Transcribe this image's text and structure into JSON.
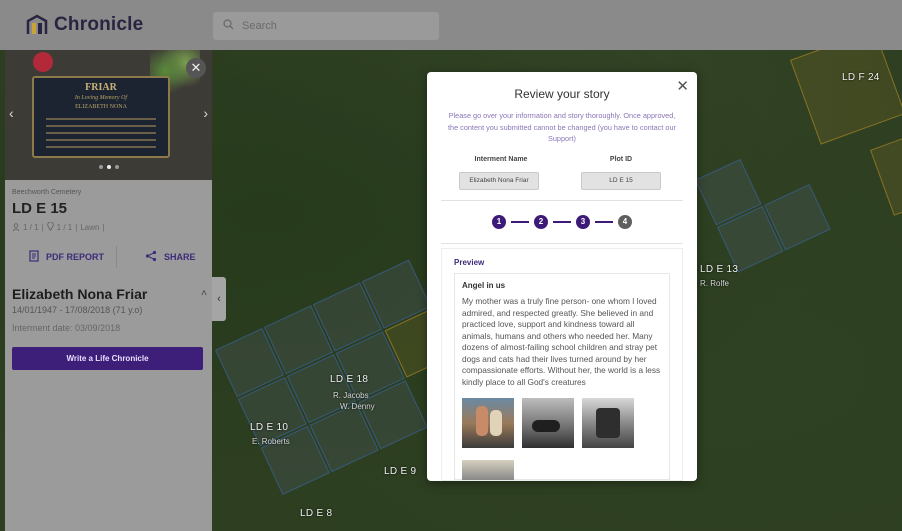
{
  "app": {
    "name": "Chronicle"
  },
  "search": {
    "placeholder": "Search"
  },
  "panel": {
    "cemetery": "Beechworth Cemetery",
    "plot_id": "LD E 15",
    "meta": {
      "people": "1 / 1",
      "plots": "1 / 1",
      "type": "Lawn"
    },
    "plaque": {
      "surname": "FRIAR",
      "subtitle": "In Loving Memory Of",
      "name": "ELIZABETH NONA"
    },
    "pdf_label": "PDF REPORT",
    "share_label": "SHARE",
    "person_name": "Elizabeth Nona Friar",
    "dates": "14/01/1947 - 17/08/2018 (71 y.o)",
    "interment": "Interment date: 03/09/2018",
    "life_button": "Write a Life Chronicle"
  },
  "map": {
    "labels": [
      "LD F 24",
      "LD E 13",
      "LD E 18",
      "LD E 10",
      "LD E 9",
      "LD E 8"
    ],
    "sublabels": [
      "R. Rolfe",
      "R. Jacobs",
      "W. Denny",
      "E. Roberts"
    ]
  },
  "modal": {
    "title": "Review your story",
    "description": "Please go over your information and story thoroughly. Once approved, the content you submitted cannot be changed (you have to contact our Support)",
    "interment_label": "Interment Name",
    "plot_label": "Plot ID",
    "interment_value": "Elizabeth Nona Friar",
    "plot_value": "LD E 15",
    "steps": [
      "1",
      "2",
      "3",
      "4"
    ],
    "preview_label": "Preview",
    "story_title": "Angel in us",
    "story_body": "My mother was a truly fine person- one whom I loved admired, and respected greatly. She believed in and practiced love, support and kindness toward all animals, humans and others who needed her. Many dozens of almost-failing school children and stray pet dogs and cats had their lives turned around by her compassionate efforts. Without her, the world is a less kindly place to all God's creatures"
  },
  "colors": {
    "accent": "#3e1a78",
    "brand_text": "#2b2440"
  }
}
